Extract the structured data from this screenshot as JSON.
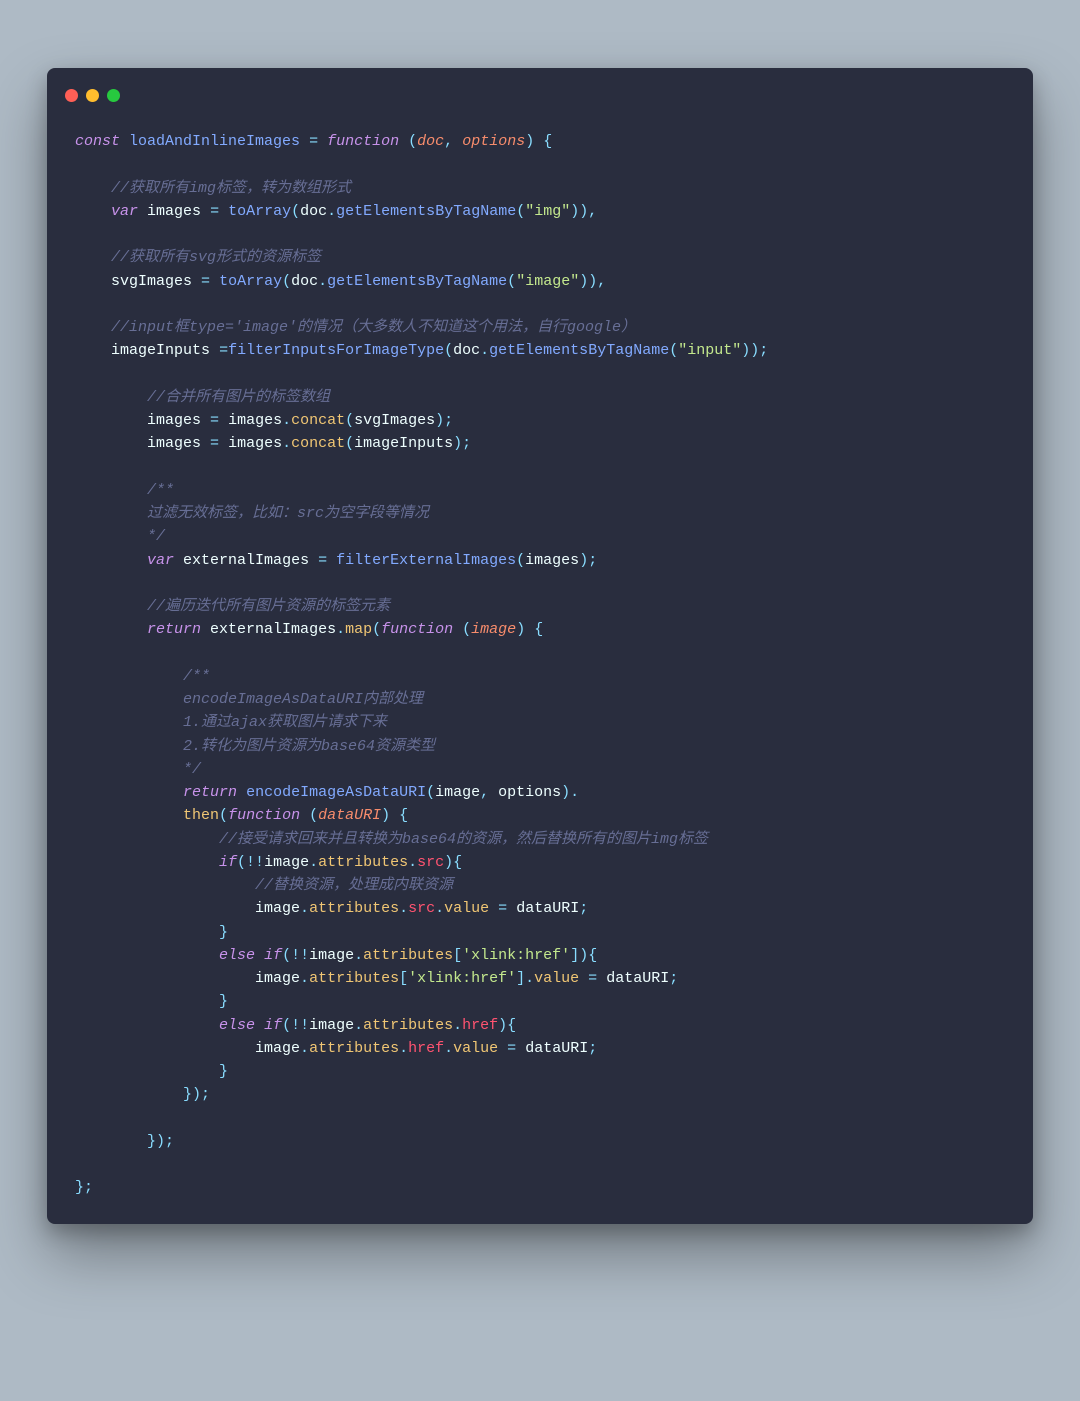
{
  "window": {
    "controls": [
      "close",
      "minimize",
      "zoom"
    ]
  },
  "colors": {
    "bg_page": "#aebac5",
    "bg_window": "#292d3e",
    "keyword": "#c792ea",
    "function": "#82aaff",
    "identifier": "#eeffff",
    "operator": "#89ddff",
    "string": "#c3e88d",
    "call": "#f0c674",
    "comment": "#676e95",
    "property": "#ff5370",
    "param": "#f78c6c"
  },
  "code": {
    "lines": [
      [
        [
          "kw",
          "const"
        ],
        [
          "sp",
          " "
        ],
        [
          "def",
          "loadAndInlineImages"
        ],
        [
          "sp",
          " "
        ],
        [
          "op",
          "="
        ],
        [
          "sp",
          " "
        ],
        [
          "kw",
          "function"
        ],
        [
          "sp",
          " "
        ],
        [
          "op",
          "("
        ],
        [
          "param",
          "doc"
        ],
        [
          "op",
          ","
        ],
        [
          "sp",
          " "
        ],
        [
          "param",
          "options"
        ],
        [
          "op",
          ")"
        ],
        [
          "sp",
          " "
        ],
        [
          "op",
          "{"
        ]
      ],
      [],
      [
        [
          "sp",
          "    "
        ],
        [
          "cmt",
          "//获取所有img标签，转为数组形式"
        ]
      ],
      [
        [
          "sp",
          "    "
        ],
        [
          "kw",
          "var"
        ],
        [
          "sp",
          " "
        ],
        [
          "var",
          "images"
        ],
        [
          "sp",
          " "
        ],
        [
          "op",
          "="
        ],
        [
          "sp",
          " "
        ],
        [
          "def",
          "toArray"
        ],
        [
          "op",
          "("
        ],
        [
          "var",
          "doc"
        ],
        [
          "op",
          "."
        ],
        [
          "def",
          "getElementsByTagName"
        ],
        [
          "op",
          "("
        ],
        [
          "str",
          "\"img\""
        ],
        [
          "op",
          "))"
        ],
        [
          "op",
          ","
        ]
      ],
      [],
      [
        [
          "sp",
          "    "
        ],
        [
          "cmt",
          "//获取所有svg形式的资源标签"
        ]
      ],
      [
        [
          "sp",
          "    "
        ],
        [
          "var",
          "svgImages"
        ],
        [
          "sp",
          " "
        ],
        [
          "op",
          "="
        ],
        [
          "sp",
          " "
        ],
        [
          "def",
          "toArray"
        ],
        [
          "op",
          "("
        ],
        [
          "var",
          "doc"
        ],
        [
          "op",
          "."
        ],
        [
          "def",
          "getElementsByTagName"
        ],
        [
          "op",
          "("
        ],
        [
          "str",
          "\"image\""
        ],
        [
          "op",
          "))"
        ],
        [
          "op",
          ","
        ]
      ],
      [],
      [
        [
          "sp",
          "    "
        ],
        [
          "cmt",
          "//input框type='image'的情况（大多数人不知道这个用法，自行google）"
        ]
      ],
      [
        [
          "sp",
          "    "
        ],
        [
          "var",
          "imageInputs"
        ],
        [
          "sp",
          " "
        ],
        [
          "op",
          "="
        ],
        [
          "def",
          "filterInputsForImageType"
        ],
        [
          "op",
          "("
        ],
        [
          "var",
          "doc"
        ],
        [
          "op",
          "."
        ],
        [
          "def",
          "getElementsByTagName"
        ],
        [
          "op",
          "("
        ],
        [
          "str",
          "\"input\""
        ],
        [
          "op",
          "));"
        ]
      ],
      [],
      [
        [
          "sp",
          "        "
        ],
        [
          "cmt",
          "//合并所有图片的标签数组"
        ]
      ],
      [
        [
          "sp",
          "        "
        ],
        [
          "var",
          "images"
        ],
        [
          "sp",
          " "
        ],
        [
          "op",
          "="
        ],
        [
          "sp",
          " "
        ],
        [
          "var",
          "images"
        ],
        [
          "op",
          "."
        ],
        [
          "call",
          "concat"
        ],
        [
          "op",
          "("
        ],
        [
          "var",
          "svgImages"
        ],
        [
          "op",
          ");"
        ]
      ],
      [
        [
          "sp",
          "        "
        ],
        [
          "var",
          "images"
        ],
        [
          "sp",
          " "
        ],
        [
          "op",
          "="
        ],
        [
          "sp",
          " "
        ],
        [
          "var",
          "images"
        ],
        [
          "op",
          "."
        ],
        [
          "call",
          "concat"
        ],
        [
          "op",
          "("
        ],
        [
          "var",
          "imageInputs"
        ],
        [
          "op",
          ");"
        ]
      ],
      [],
      [
        [
          "sp",
          "        "
        ],
        [
          "cmt",
          "/**"
        ]
      ],
      [
        [
          "sp",
          "        "
        ],
        [
          "cmt",
          "过滤无效标签，比如：src为空字段等情况"
        ]
      ],
      [
        [
          "sp",
          "        "
        ],
        [
          "cmt",
          "*/"
        ]
      ],
      [
        [
          "sp",
          "        "
        ],
        [
          "kw",
          "var"
        ],
        [
          "sp",
          " "
        ],
        [
          "var",
          "externalImages"
        ],
        [
          "sp",
          " "
        ],
        [
          "op",
          "="
        ],
        [
          "sp",
          " "
        ],
        [
          "def",
          "filterExternalImages"
        ],
        [
          "op",
          "("
        ],
        [
          "var",
          "images"
        ],
        [
          "op",
          ");"
        ]
      ],
      [],
      [
        [
          "sp",
          "        "
        ],
        [
          "cmt",
          "//遍历迭代所有图片资源的标签元素"
        ]
      ],
      [
        [
          "sp",
          "        "
        ],
        [
          "kw",
          "return"
        ],
        [
          "sp",
          " "
        ],
        [
          "var",
          "externalImages"
        ],
        [
          "op",
          "."
        ],
        [
          "call",
          "map"
        ],
        [
          "op",
          "("
        ],
        [
          "kw",
          "function"
        ],
        [
          "sp",
          " "
        ],
        [
          "op",
          "("
        ],
        [
          "param",
          "image"
        ],
        [
          "op",
          ")"
        ],
        [
          "sp",
          " "
        ],
        [
          "op",
          "{"
        ]
      ],
      [],
      [
        [
          "sp",
          "            "
        ],
        [
          "cmt",
          "/**"
        ]
      ],
      [
        [
          "sp",
          "            "
        ],
        [
          "cmt",
          "encodeImageAsDataURI内部处理"
        ]
      ],
      [
        [
          "sp",
          "            "
        ],
        [
          "cmt",
          "1.通过ajax获取图片请求下来"
        ]
      ],
      [
        [
          "sp",
          "            "
        ],
        [
          "cmt",
          "2.转化为图片资源为base64资源类型"
        ]
      ],
      [
        [
          "sp",
          "            "
        ],
        [
          "cmt",
          "*/"
        ]
      ],
      [
        [
          "sp",
          "            "
        ],
        [
          "kw",
          "return"
        ],
        [
          "sp",
          " "
        ],
        [
          "def",
          "encodeImageAsDataURI"
        ],
        [
          "op",
          "("
        ],
        [
          "var",
          "image"
        ],
        [
          "op",
          ","
        ],
        [
          "sp",
          " "
        ],
        [
          "var",
          "options"
        ],
        [
          "op",
          ")."
        ]
      ],
      [
        [
          "sp",
          "            "
        ],
        [
          "call",
          "then"
        ],
        [
          "op",
          "("
        ],
        [
          "kw",
          "function"
        ],
        [
          "sp",
          " "
        ],
        [
          "op",
          "("
        ],
        [
          "param",
          "dataURI"
        ],
        [
          "op",
          ")"
        ],
        [
          "sp",
          " "
        ],
        [
          "op",
          "{"
        ]
      ],
      [
        [
          "sp",
          "                "
        ],
        [
          "cmt",
          "//接受请求回来并且转换为base64的资源，然后替换所有的图片img标签"
        ]
      ],
      [
        [
          "sp",
          "                "
        ],
        [
          "kw",
          "if"
        ],
        [
          "op",
          "(!!"
        ],
        [
          "var",
          "image"
        ],
        [
          "op",
          "."
        ],
        [
          "call",
          "attributes"
        ],
        [
          "op",
          "."
        ],
        [
          "prop",
          "src"
        ],
        [
          "op",
          "){"
        ]
      ],
      [
        [
          "sp",
          "                    "
        ],
        [
          "cmt",
          "//替换资源，处理成内联资源"
        ]
      ],
      [
        [
          "sp",
          "                    "
        ],
        [
          "var",
          "image"
        ],
        [
          "op",
          "."
        ],
        [
          "call",
          "attributes"
        ],
        [
          "op",
          "."
        ],
        [
          "prop",
          "src"
        ],
        [
          "op",
          "."
        ],
        [
          "call",
          "value"
        ],
        [
          "sp",
          " "
        ],
        [
          "op",
          "="
        ],
        [
          "sp",
          " "
        ],
        [
          "var",
          "dataURI"
        ],
        [
          "op",
          ";"
        ]
      ],
      [
        [
          "sp",
          "                "
        ],
        [
          "op",
          "}"
        ]
      ],
      [
        [
          "sp",
          "                "
        ],
        [
          "kw",
          "else"
        ],
        [
          "sp",
          " "
        ],
        [
          "kw",
          "if"
        ],
        [
          "op",
          "(!!"
        ],
        [
          "var",
          "image"
        ],
        [
          "op",
          "."
        ],
        [
          "call",
          "attributes"
        ],
        [
          "op",
          "["
        ],
        [
          "str",
          "'xlink:href'"
        ],
        [
          "op",
          "]){"
        ]
      ],
      [
        [
          "sp",
          "                    "
        ],
        [
          "var",
          "image"
        ],
        [
          "op",
          "."
        ],
        [
          "call",
          "attributes"
        ],
        [
          "op",
          "["
        ],
        [
          "str",
          "'xlink:href'"
        ],
        [
          "op",
          "]."
        ],
        [
          "call",
          "value"
        ],
        [
          "sp",
          " "
        ],
        [
          "op",
          "="
        ],
        [
          "sp",
          " "
        ],
        [
          "var",
          "dataURI"
        ],
        [
          "op",
          ";"
        ]
      ],
      [
        [
          "sp",
          "                "
        ],
        [
          "op",
          "}"
        ]
      ],
      [
        [
          "sp",
          "                "
        ],
        [
          "kw",
          "else"
        ],
        [
          "sp",
          " "
        ],
        [
          "kw",
          "if"
        ],
        [
          "op",
          "(!!"
        ],
        [
          "var",
          "image"
        ],
        [
          "op",
          "."
        ],
        [
          "call",
          "attributes"
        ],
        [
          "op",
          "."
        ],
        [
          "prop",
          "href"
        ],
        [
          "op",
          "){"
        ]
      ],
      [
        [
          "sp",
          "                    "
        ],
        [
          "var",
          "image"
        ],
        [
          "op",
          "."
        ],
        [
          "call",
          "attributes"
        ],
        [
          "op",
          "."
        ],
        [
          "prop",
          "href"
        ],
        [
          "op",
          "."
        ],
        [
          "call",
          "value"
        ],
        [
          "sp",
          " "
        ],
        [
          "op",
          "="
        ],
        [
          "sp",
          " "
        ],
        [
          "var",
          "dataURI"
        ],
        [
          "op",
          ";"
        ]
      ],
      [
        [
          "sp",
          "                "
        ],
        [
          "op",
          "}"
        ]
      ],
      [
        [
          "sp",
          "            "
        ],
        [
          "op",
          "});"
        ]
      ],
      [],
      [
        [
          "sp",
          "        "
        ],
        [
          "op",
          "});"
        ]
      ],
      [],
      [
        [
          "op",
          "};"
        ]
      ]
    ]
  }
}
